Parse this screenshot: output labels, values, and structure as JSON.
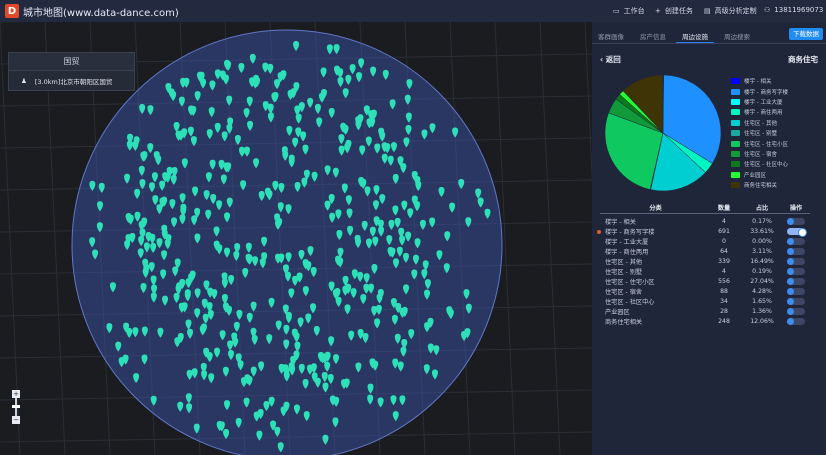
{
  "header": {
    "logo": "D",
    "title": "城市地图(www.data-dance.com)",
    "items": [
      {
        "icon": "monitor-icon",
        "label": "工作台"
      },
      {
        "icon": "plus-icon",
        "label": "创建任务"
      },
      {
        "icon": "document-icon",
        "label": "高级分析定制"
      },
      {
        "icon": "user-icon",
        "label": "13811969073"
      }
    ]
  },
  "left_panel": {
    "title": "国贸",
    "item": "[3.0km]北京市朝阳区国贸",
    "item_icon": "location-pin-icon"
  },
  "map": {
    "zoom_in": "+",
    "zoom_out": "−",
    "marker_color": "#2de0b8",
    "circle_color": "#3a4f9a"
  },
  "panel": {
    "tabs": [
      {
        "label": "客群画像"
      },
      {
        "label": "房产信息"
      },
      {
        "label": "周边设施",
        "active": true
      },
      {
        "label": "周边搜索"
      }
    ],
    "download": "下载数据",
    "back": "返回",
    "category": "商务住宅",
    "table_headers": [
      "分类",
      "数量",
      "占比",
      "操作"
    ],
    "rows": [
      {
        "name": "楼宇 - 相关",
        "count": "4",
        "pct": "0.17%",
        "on": false,
        "color": "#0000ff",
        "value": 4
      },
      {
        "name": "楼宇 - 商务写字楼",
        "count": "691",
        "pct": "33.61%",
        "on": true,
        "color": "#1e90ff",
        "value": 691
      },
      {
        "name": "楼宇 - 工业大厦",
        "count": "0",
        "pct": "0.00%",
        "on": false,
        "color": "#00ffff",
        "value": 0
      },
      {
        "name": "楼宇 - 商住两用",
        "count": "64",
        "pct": "3.11%",
        "on": false,
        "color": "#00f5c0",
        "value": 64
      },
      {
        "name": "住宅区 - 其他",
        "count": "339",
        "pct": "16.49%",
        "on": false,
        "color": "#00ced1",
        "value": 339
      },
      {
        "name": "住宅区 - 别墅",
        "count": "4",
        "pct": "0.19%",
        "on": false,
        "color": "#1aa8a0",
        "value": 4
      },
      {
        "name": "住宅区 - 住宅小区",
        "count": "556",
        "pct": "27.04%",
        "on": false,
        "color": "#10c860",
        "value": 556
      },
      {
        "name": "住宅区 - 宿舍",
        "count": "88",
        "pct": "4.28%",
        "on": false,
        "color": "#119a3a",
        "value": 88
      },
      {
        "name": "住宅区 - 社区中心",
        "count": "34",
        "pct": "1.65%",
        "on": false,
        "color": "#0a7a1a",
        "value": 34
      },
      {
        "name": "产业园区",
        "count": "28",
        "pct": "1.36%",
        "on": false,
        "color": "#22ff33",
        "value": 28
      },
      {
        "name": "商务住宅相关",
        "count": "248",
        "pct": "12.06%",
        "on": false,
        "color": "#3e3406",
        "value": 248
      }
    ]
  }
}
